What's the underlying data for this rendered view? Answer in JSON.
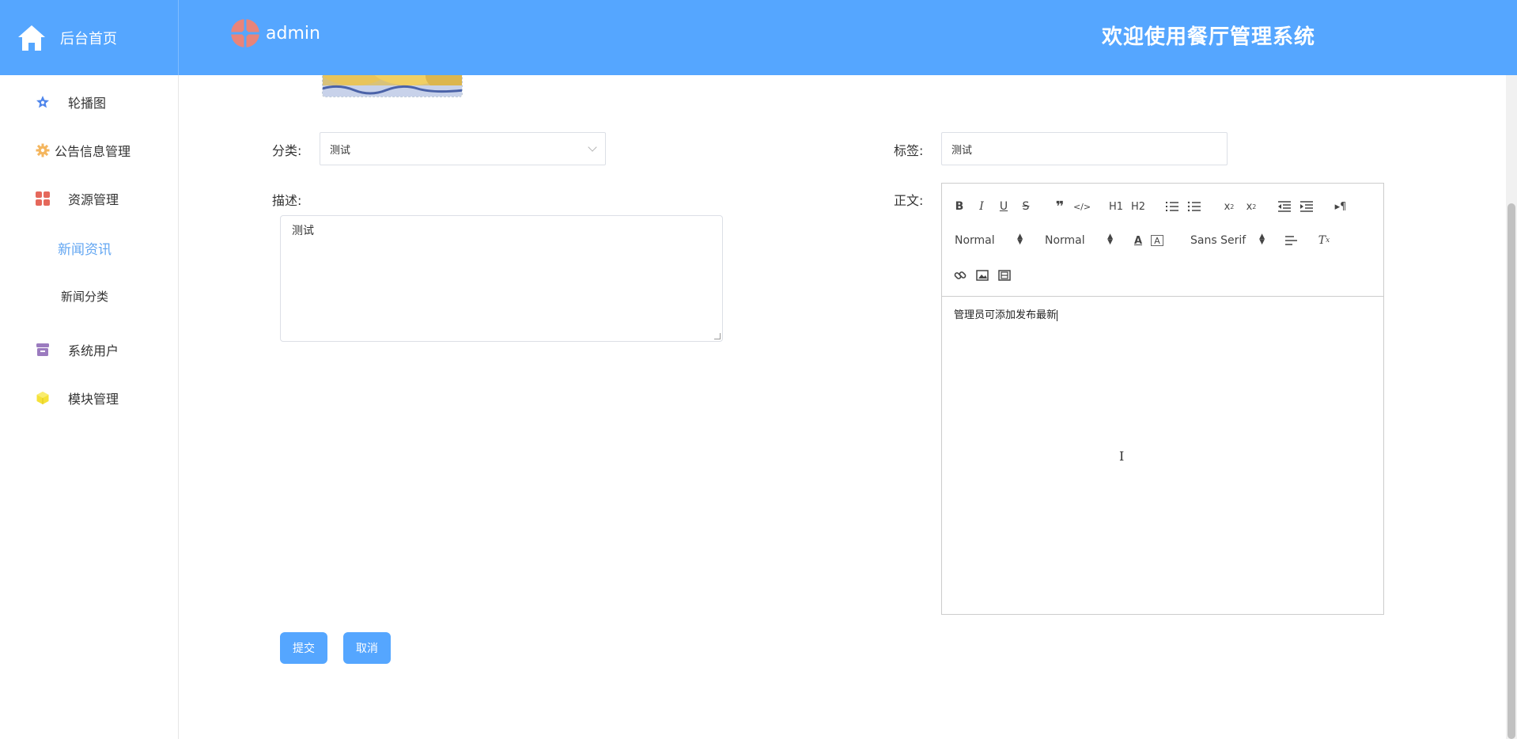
{
  "header": {
    "brand_label": "后台首页",
    "username": "admin",
    "welcome": "欢迎使用餐厅管理系统"
  },
  "sidebar": {
    "items": [
      {
        "label": "轮播图",
        "icon": "star-icon",
        "color": "#4f86ec"
      },
      {
        "label": "公告信息管理",
        "icon": "gear-icon",
        "color": "#f4b65f"
      },
      {
        "label": "资源管理",
        "icon": "grid-icon",
        "color": "#e5685b"
      },
      {
        "label": "新闻资讯"
      },
      {
        "label": "新闻分类"
      },
      {
        "label": "系统用户",
        "icon": "archive-icon",
        "color": "#9b7bbf"
      },
      {
        "label": "模块管理",
        "icon": "cube-icon",
        "color": "#f5e138"
      }
    ],
    "active": "新闻资讯"
  },
  "form": {
    "category_label": "分类:",
    "category_value": "测试",
    "tags_label": "标签:",
    "tags_value": "测试",
    "description_label": "描述:",
    "description_value": "测试",
    "body_label": "正文:",
    "body_value": "管理员可添加发布最新"
  },
  "editor_toolbar": {
    "size_picker": "Normal",
    "header_picker": "Normal",
    "font_picker": "Sans Serif",
    "h1": "H1",
    "h2": "H2"
  },
  "buttons": {
    "submit": "提交",
    "cancel": "取消"
  },
  "colors": {
    "header_bg": "#55a6ff",
    "active_menu": "#62a6f2",
    "button": "#55a6ff"
  }
}
